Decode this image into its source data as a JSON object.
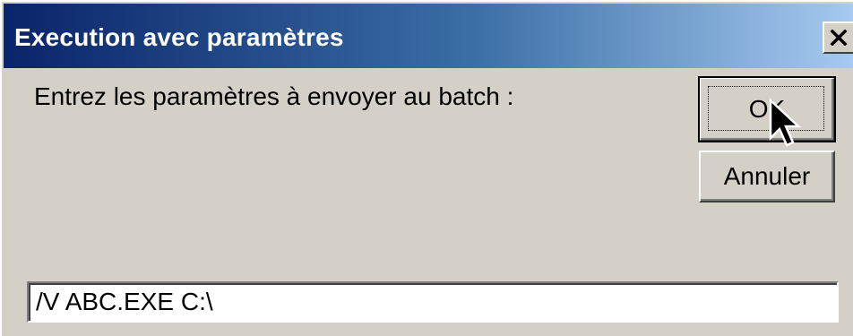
{
  "window": {
    "title": "Execution avec paramètres"
  },
  "dialog": {
    "prompt": "Entrez les paramètres à envoyer au batch :",
    "parameters_value": "/V ABC.EXE C:\\"
  },
  "buttons": {
    "ok_label": "OK",
    "cancel_label": "Annuler"
  },
  "icons": {
    "close": "close-icon",
    "cursor": "mouse-pointer-icon"
  },
  "colors": {
    "titlebar_start": "#0a246a",
    "titlebar_end": "#a6caf0",
    "face": "#d4d0c8"
  }
}
